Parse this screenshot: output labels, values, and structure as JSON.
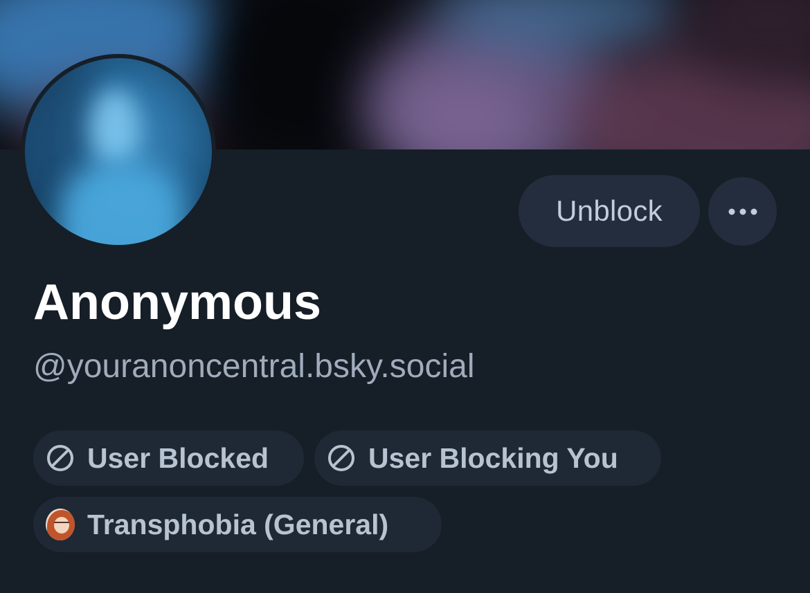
{
  "profile": {
    "display_name": "Anonymous",
    "handle": "@youranoncentral.bsky.social"
  },
  "actions": {
    "unblock_label": "Unblock",
    "more_icon": "ellipsis-icon"
  },
  "labels": [
    {
      "text": "User Blocked",
      "icon": "block-icon"
    },
    {
      "text": "User Blocking You",
      "icon": "block-icon"
    },
    {
      "text": "Transphobia (General)",
      "icon": "labeler-avatar"
    }
  ],
  "colors": {
    "background": "#161e27",
    "button_bg": "#232d3d",
    "pill_bg": "#1f2835",
    "name_text": "#ffffff",
    "handle_text": "#a0acbc",
    "pill_text": "#b8c3d2"
  }
}
